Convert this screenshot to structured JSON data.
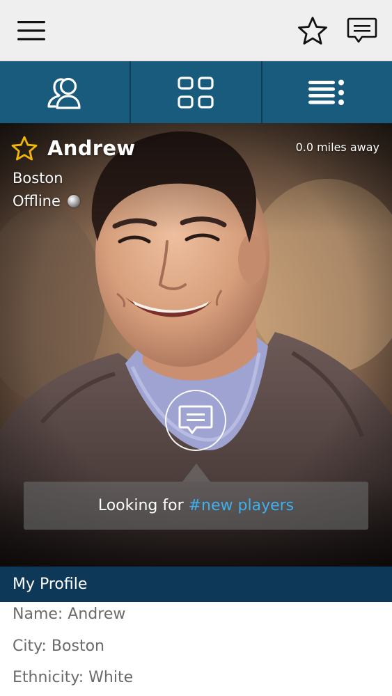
{
  "topbar": {
    "menu_icon": "hamburger-menu-icon",
    "favorite_icon": "star-outline-icon",
    "messages_icon": "chat-message-icon"
  },
  "tabs": [
    {
      "icon": "users-icon"
    },
    {
      "icon": "grid-icon"
    },
    {
      "icon": "list-menu-icon"
    }
  ],
  "profile": {
    "name": "Andrew",
    "distance": "0.0 miles away",
    "city": "Boston",
    "status": "Offline",
    "looking_for_prefix": "Looking for",
    "looking_for_tag": "#new players"
  },
  "section": {
    "title": "My Profile"
  },
  "details": [
    "Name: Andrew",
    "City: Boston",
    "Ethnicity: White"
  ],
  "colors": {
    "topbar_bg": "#efeff0",
    "tabs_bg": "#195b7c",
    "section_header_bg": "#0e3858",
    "star_gold": "#f2b705",
    "hashtag_blue": "#3fb0ee",
    "detail_text": "#6a6a6a"
  }
}
